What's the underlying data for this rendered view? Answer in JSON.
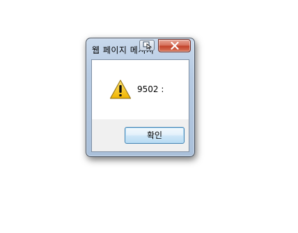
{
  "dialog": {
    "title": "웹 페이지 메시지",
    "message": "9502 :",
    "ok_label": "확인"
  },
  "icons": {
    "titlebar": "cursor-icon",
    "close": "close-icon",
    "message": "warning-icon"
  },
  "colors": {
    "titlebar": "#b7cbe3",
    "close_button": "#c2432b",
    "ok_border": "#3c7fb1",
    "warning_fill": "#f5c400"
  }
}
